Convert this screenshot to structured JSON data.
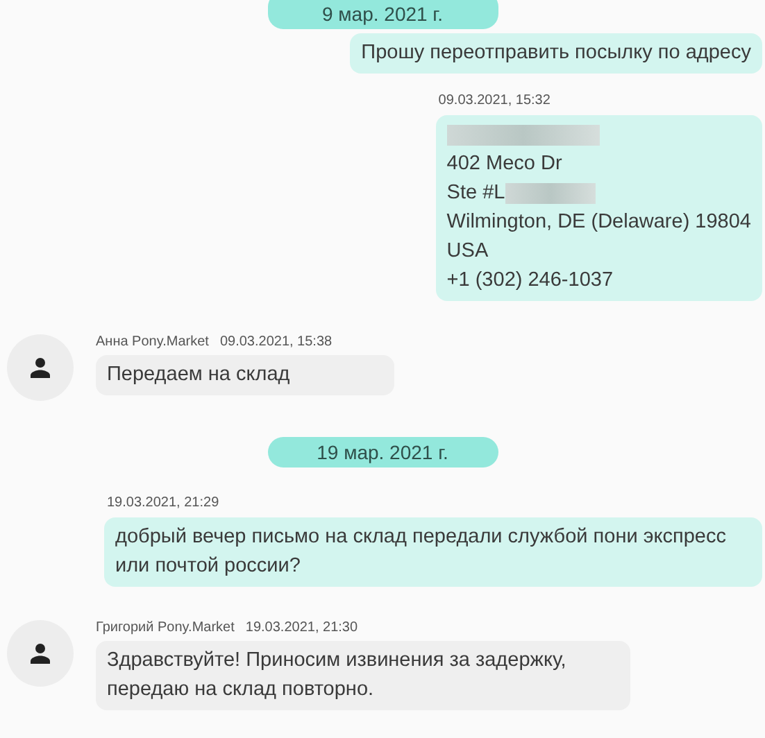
{
  "items": [
    {
      "kind": "date",
      "text": "9 мар. 2021 г."
    },
    {
      "kind": "outgoing",
      "lines": [
        {
          "kind": "text",
          "text": "Прошу переотправить посылку по адресу"
        }
      ]
    },
    {
      "kind": "outgoing",
      "time": "09.03.2021, 15:32",
      "lines": [
        {
          "kind": "redacted"
        },
        {
          "kind": "text",
          "text": "402 Meco Dr"
        },
        {
          "kind": "partial",
          "text": "Ste #L"
        },
        {
          "kind": "text",
          "text": "Wilmington,  DE (Delaware) 19804"
        },
        {
          "kind": "text",
          "text": "USA"
        },
        {
          "kind": "text",
          "text": "+1 (302) 246-1037"
        }
      ]
    },
    {
      "kind": "incoming",
      "author": "Анна Pony.Market",
      "time": "09.03.2021, 15:38",
      "lines": [
        {
          "kind": "text",
          "text": "Передаем на склад"
        }
      ]
    },
    {
      "kind": "date",
      "text": "19 мар. 2021 г."
    },
    {
      "kind": "outgoing",
      "time": "19.03.2021, 21:29",
      "lines": [
        {
          "kind": "text",
          "text": "добрый вечер письмо на склад передали службой пони экспресс или почтой россии?"
        }
      ]
    },
    {
      "kind": "incoming",
      "author": "Григорий Pony.Market",
      "time": "19.03.2021, 21:30",
      "lines": [
        {
          "kind": "text",
          "text": "Здравствуйте! Приносим извинения за задержку, передаю на склад повторно."
        }
      ]
    }
  ]
}
